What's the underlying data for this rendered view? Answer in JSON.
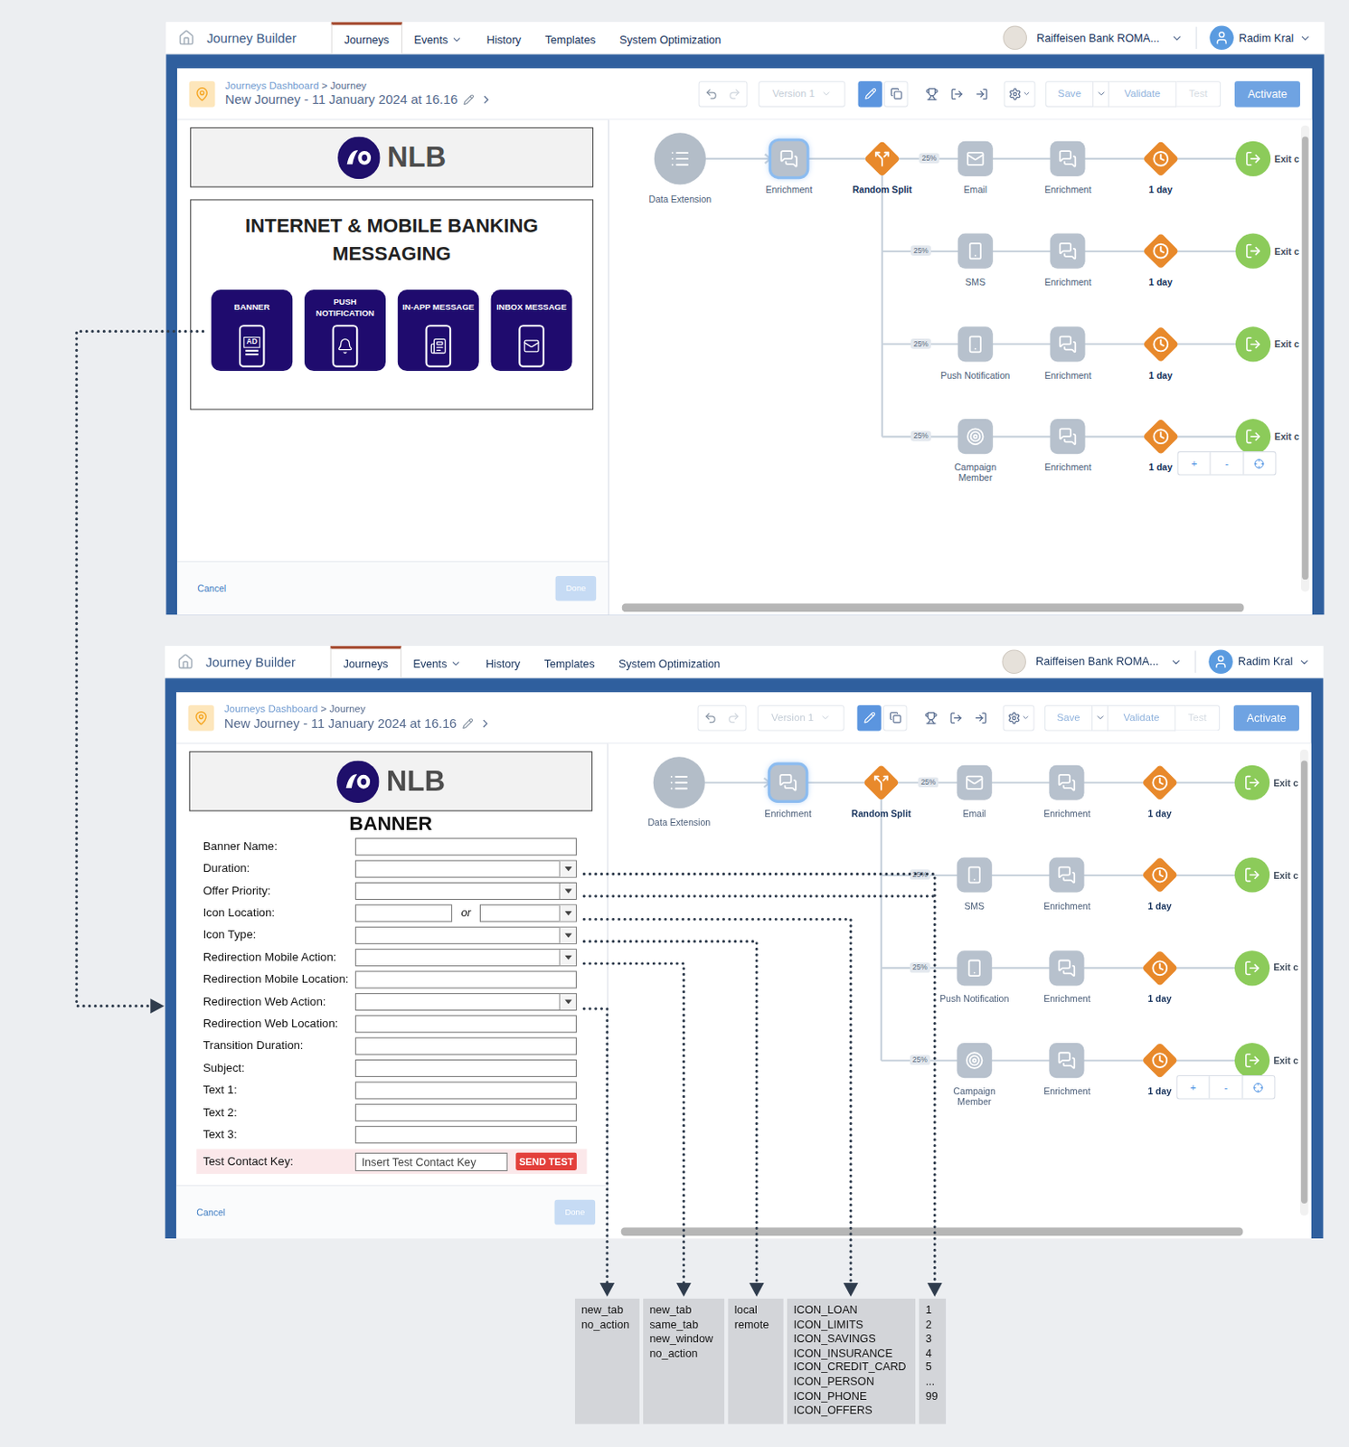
{
  "journey_builder": {
    "app_title": "Journey Builder",
    "tabs": [
      {
        "label": "Journeys",
        "selected": true,
        "dropdown": false
      },
      {
        "label": "Events",
        "selected": false,
        "dropdown": true
      },
      {
        "label": "History",
        "selected": false,
        "dropdown": false
      },
      {
        "label": "Templates",
        "selected": false,
        "dropdown": false
      },
      {
        "label": "System Optimization",
        "selected": false,
        "dropdown": false
      }
    ],
    "business_unit": "Raiffeisen Bank ROMA...",
    "user": "Radim Kral",
    "breadcrumb": [
      "Journeys Dashboard",
      "Journey"
    ],
    "breadcrumb_separator": ">",
    "journey_name": "New Journey - 11 January 2024 at 16.16",
    "toolbar": {
      "version": "Version 1",
      "version_disabled": true,
      "save": "Save",
      "validate": "Validate",
      "test": "Test",
      "test_disabled": true,
      "activate": "Activate",
      "edit_selected": true
    },
    "canvas": {
      "entry": "Data Extension",
      "enrichment": {
        "label": "Enrichment",
        "selected": true
      },
      "split": "Random Split",
      "branches": [
        {
          "share": "25%",
          "activity": "Email",
          "kind": "email",
          "enrichment": "Enrichment",
          "wait": "1 day",
          "exit": "Exit c"
        },
        {
          "share": "25%",
          "activity": "SMS",
          "kind": "sms",
          "enrichment": "Enrichment",
          "wait": "1 day",
          "exit": "Exit c"
        },
        {
          "share": "25%",
          "activity": "Push Notification",
          "kind": "push",
          "enrichment": "Enrichment",
          "wait": "1 day",
          "exit": "Exit c"
        },
        {
          "share": "25%",
          "activity": "Campaign Member",
          "kind": "campaign",
          "enrichment": "Enrichment",
          "wait": "1 day",
          "exit": "Exit c"
        }
      ],
      "zoom": [
        "+",
        "-"
      ]
    },
    "footer": {
      "cancel": "Cancel",
      "done": "Done",
      "done_disabled": true
    }
  },
  "messaging_screen": {
    "brand": "NLB",
    "title": "INTERNET & MOBILE BANKING MESSAGING",
    "channels": [
      {
        "label": "BANNER",
        "kind": "banner",
        "icon_text": "AD"
      },
      {
        "label": "PUSH NOTIFICATION",
        "kind": "push",
        "icon_text": ""
      },
      {
        "label": "IN-APP MESSAGE",
        "kind": "in-app",
        "icon_text": ""
      },
      {
        "label": "INBOX MESSAGE",
        "kind": "inbox",
        "icon_text": ""
      }
    ]
  },
  "banner_screen": {
    "brand": "NLB",
    "title": "BANNER",
    "or": "or",
    "fields": [
      {
        "label": "Banner Name:",
        "kind": "text"
      },
      {
        "label": "Duration:",
        "kind": "select"
      },
      {
        "label": "Offer Priority:",
        "kind": "select"
      },
      {
        "label": "Icon Location:",
        "kind": "location"
      },
      {
        "label": "Icon Type:",
        "kind": "select"
      },
      {
        "label": "Redirection Mobile Action:",
        "kind": "select"
      },
      {
        "label": "Redirection Mobile Location:",
        "kind": "text"
      },
      {
        "label": "Redirection Web Action:",
        "kind": "select"
      },
      {
        "label": "Redirection Web Location:",
        "kind": "text"
      },
      {
        "label": "Transition Duration:",
        "kind": "text"
      },
      {
        "label": "Subject:",
        "kind": "text"
      },
      {
        "label": "Text 1:",
        "kind": "text"
      },
      {
        "label": "Text 2:",
        "kind": "text"
      },
      {
        "label": "Text 3:",
        "kind": "text"
      }
    ],
    "test": {
      "label": "Test Contact Key:",
      "placeholder": "Insert Test Contact Key",
      "button": "SEND TEST"
    }
  },
  "option_lists": [
    {
      "options": [
        "new_tab",
        "no_action"
      ]
    },
    {
      "options": [
        "new_tab",
        "same_tab",
        "new_window",
        "no_action"
      ]
    },
    {
      "options": [
        "local",
        "remote"
      ]
    },
    {
      "options": [
        "ICON_LOAN",
        "ICON_LIMITS",
        "ICON_SAVINGS",
        "ICON_INSURANCE",
        "ICON_CREDIT_CARD",
        "ICON_PERSON",
        "ICON_PHONE",
        "ICON_OFFERS"
      ]
    },
    {
      "options": [
        "1",
        "2",
        "3",
        "4",
        "5",
        "...",
        "99"
      ]
    }
  ]
}
